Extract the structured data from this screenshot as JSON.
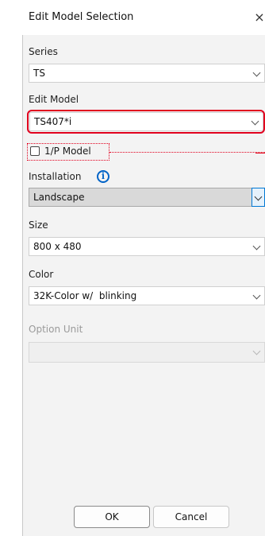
{
  "dialog": {
    "title": "Edit Model Selection",
    "close_glyph": "×"
  },
  "fields": {
    "series": {
      "label": "Series",
      "value": "TS"
    },
    "edit_model": {
      "label": "Edit Model",
      "value": "TS407*i"
    },
    "ip_model": {
      "label": "1/P Model",
      "checked": false
    },
    "installation": {
      "label": "Installation",
      "value": "Landscape",
      "info_icon": "info-icon"
    },
    "size": {
      "label": "Size",
      "value": "800 x 480"
    },
    "color": {
      "label": "Color",
      "value": "32K-Color w/  blinking"
    },
    "option_unit": {
      "label": "Option Unit",
      "value": "",
      "disabled": true
    }
  },
  "buttons": {
    "ok": "OK",
    "cancel": "Cancel"
  },
  "annotation_color": "#e1001e",
  "accent": "#0078d4"
}
